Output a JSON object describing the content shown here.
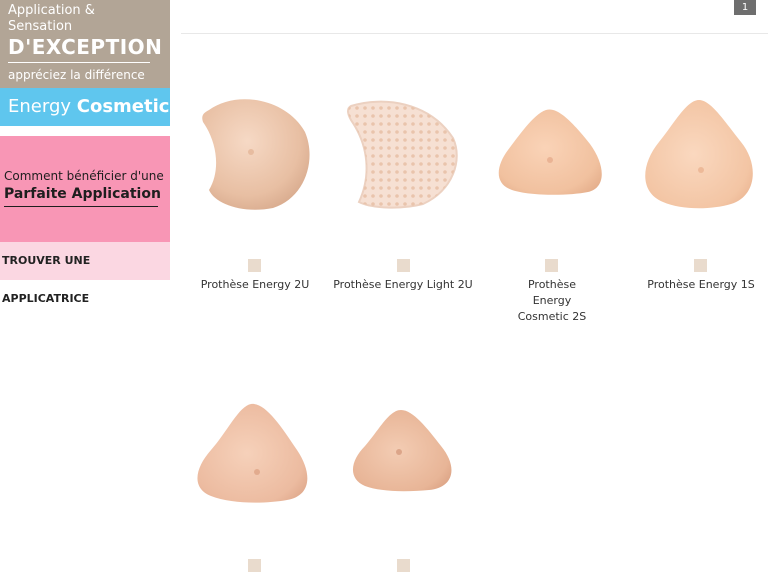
{
  "sidebar": {
    "promo1": {
      "line1": "Application & Sensation",
      "line2": "D'EXCEPTION",
      "line3": "appréciez la différence"
    },
    "promo2": {
      "word1": "Energy",
      "word2": "Cosmetic"
    },
    "promo3": {
      "line1": "Comment bénéficier d'une",
      "line2": "Parfaite Application"
    },
    "find_link": "TROUVER UNE APPLICATRICE"
  },
  "pagination": {
    "current": "1"
  },
  "colors": {
    "brown": "#b2a596",
    "blue": "#5fc6ee",
    "pink": "#f896b5",
    "light_pink": "#fbd7e2",
    "swatch": "#e9dbcd",
    "skin": "#f0c4a8"
  },
  "products": [
    {
      "name": "Prothèse Energy 2U",
      "icon": "prosthesis-2u-image"
    },
    {
      "name": "Prothèse Energy Light 2U",
      "icon": "prosthesis-light-2u-image"
    },
    {
      "name": "Prothèse Energy Cosmetic 2S",
      "icon": "prosthesis-cosmetic-2s-image"
    },
    {
      "name": "Prothèse Energy 1S",
      "icon": "prosthesis-1s-image"
    },
    {
      "name": "",
      "icon": "prosthesis-triangle-image"
    },
    {
      "name": "",
      "icon": "prosthesis-rounded-triangle-image"
    }
  ]
}
